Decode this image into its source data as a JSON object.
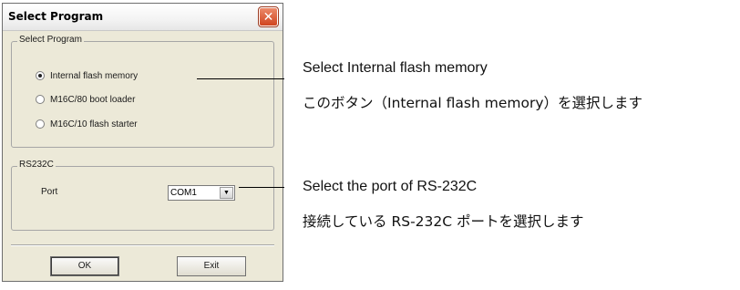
{
  "dialog": {
    "title": "Select Program",
    "close_glyph": "✕",
    "program_group": {
      "label": "Select Program",
      "options": [
        {
          "label": "Internal flash memory",
          "checked": true
        },
        {
          "label": "M16C/80 boot loader",
          "checked": false
        },
        {
          "label": "M16C/10 flash starter",
          "checked": false
        }
      ]
    },
    "rs_group": {
      "label": "RS232C",
      "port_label": "Port",
      "port_value": "COM1",
      "dropdown_glyph": "▼"
    },
    "buttons": {
      "ok": "OK",
      "exit": "Exit"
    }
  },
  "callouts": {
    "program": {
      "en": "Select Internal flash memory",
      "jp": "このボタン（Internal flash memory）を選択します"
    },
    "port": {
      "en": "Select the port of RS-232C",
      "jp": "接続している RS-232C ポートを選択します"
    }
  },
  "colors": {
    "dialog_bg": "#ece9d8",
    "close_button": "#d0441f"
  }
}
